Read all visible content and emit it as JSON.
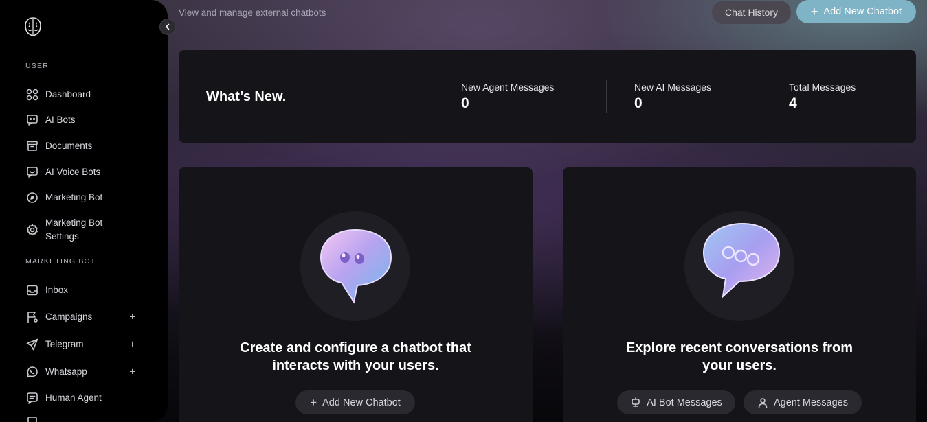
{
  "header": {
    "subtitle": "View and manage external chatbots",
    "chat_history_label": "Chat History",
    "add_chatbot_label": "Add New Chatbot"
  },
  "sidebar": {
    "section_user": "USER",
    "user_items": [
      {
        "label": "Dashboard",
        "icon": "grid-icon"
      },
      {
        "label": "AI Bots",
        "icon": "chat-bot-icon"
      },
      {
        "label": "Documents",
        "icon": "archive-icon"
      },
      {
        "label": "AI Voice Bots",
        "icon": "voice-bot-icon"
      },
      {
        "label": "Marketing Bot",
        "icon": "disc-icon"
      },
      {
        "label": "Marketing Bot Settings",
        "icon": "gear-icon"
      }
    ],
    "section_marketing": "MARKETING BOT",
    "marketing_items": [
      {
        "label": "Inbox",
        "icon": "inbox-icon"
      },
      {
        "label": "Campaigns",
        "icon": "flag-icon",
        "expandable": true
      },
      {
        "label": "Telegram",
        "icon": "send-icon",
        "expandable": true
      },
      {
        "label": "Whatsapp",
        "icon": "whatsapp-icon",
        "expandable": true
      },
      {
        "label": "Human Agent",
        "icon": "message-icon"
      }
    ]
  },
  "stats": {
    "title": "What’s New.",
    "items": [
      {
        "label": "New Agent Messages",
        "value": "0"
      },
      {
        "label": "New AI Messages",
        "value": "0"
      },
      {
        "label": "Total Messages",
        "value": "4"
      }
    ]
  },
  "cards": {
    "create": {
      "heading": "Create and configure a chatbot that interacts with your users.",
      "button_label": "Add New Chatbot"
    },
    "explore": {
      "heading": "Explore recent conversations from your users.",
      "ai_bot_button_label": "AI Bot Messages",
      "agent_button_label": "Agent Messages"
    }
  },
  "colors": {
    "accent": "#7fb3c6",
    "sidebar_bg": "#000000",
    "card_bg": "#151419"
  }
}
